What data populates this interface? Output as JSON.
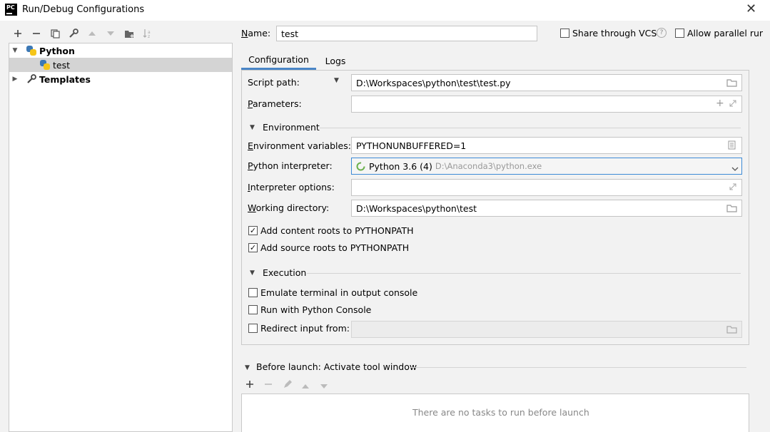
{
  "window": {
    "app_logo_text": "PC",
    "title": "Run/Debug Configurations",
    "close_symbol": "✕"
  },
  "toolbar": {
    "icons": [
      "add-icon",
      "remove-icon",
      "copy-icon",
      "wrench-icon",
      "move-up-icon",
      "move-down-icon",
      "folder-add-icon",
      "sort-icon"
    ]
  },
  "tree": {
    "python_label": "Python",
    "test_label": "test",
    "templates_label": "Templates"
  },
  "header": {
    "name_label": "Name:",
    "name_value": "test",
    "share_vcs_label": "Share through VCS",
    "allow_parallel_label": "Allow parallel run"
  },
  "tabs": [
    {
      "label": "Configuration"
    },
    {
      "label": "Logs"
    }
  ],
  "config": {
    "script_path_label": "Script path:",
    "script_path_value": "D:\\Workspaces\\python\\test\\test.py",
    "parameters_label": "Parameters:",
    "parameters_value": "",
    "environment_heading": "Environment",
    "env_vars_label": "Environment variables:",
    "env_vars_value": "PYTHONUNBUFFERED=1",
    "interpreter_label": "Python interpreter:",
    "interpreter_name": "Python 3.6 (4)",
    "interpreter_path": "D:\\Anaconda3\\python.exe",
    "interpreter_options_label": "Interpreter options:",
    "interpreter_options_value": "",
    "working_dir_label": "Working directory:",
    "working_dir_value": "D:\\Workspaces\\python\\test",
    "add_content_roots_label": "Add content roots to PYTHONPATH",
    "add_content_roots_checked": true,
    "add_source_roots_label": "Add source roots to PYTHONPATH",
    "add_source_roots_checked": true,
    "execution_heading": "Execution",
    "emulate_terminal_label": "Emulate terminal in output console",
    "emulate_terminal_checked": false,
    "run_python_console_label": "Run with Python Console",
    "run_python_console_checked": false,
    "redirect_input_label": "Redirect input from:",
    "redirect_input_checked": false,
    "redirect_input_value": ""
  },
  "before_launch": {
    "heading": "Before launch: Activate tool window",
    "empty_text": "There are no tasks to run before launch"
  },
  "colors": {
    "accent": "#4a86c7",
    "focus_border": "#3c8ad6",
    "selection": "#d4d4d4"
  }
}
